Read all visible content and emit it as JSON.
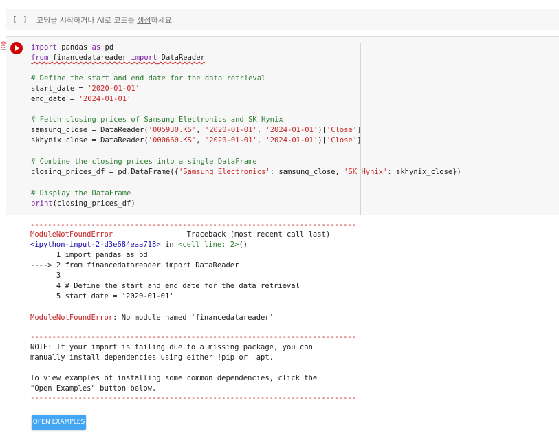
{
  "empty_cell": {
    "brackets": "[ ]",
    "placeholder_pre": "코딩을 시작하거나 AI로 코드를 ",
    "placeholder_link": "생성",
    "placeholder_post": "하세요."
  },
  "code_cell": {
    "exec_status": "0초",
    "lines": {
      "l1_kw1": "import",
      "l1_rest": " pandas ",
      "l1_kw2": "as",
      "l1_end": " pd",
      "l2_kw1": "from",
      "l2_mod": " financedatareader ",
      "l2_kw2": "import",
      "l2_end": " DataReader",
      "l4": "# Define the start and end date for the data retrieval",
      "l5_a": "start_date = ",
      "l5_s": "'2020-01-01'",
      "l6_a": "end_date = ",
      "l6_s": "'2024-01-01'",
      "l8": "# Fetch closing prices of Samsung Electronics and SK Hynix",
      "l9_a": "samsung_close = DataReader(",
      "l9_s1": "'005930.KS'",
      "l9_c1": ", ",
      "l9_s2": "'2020-01-01'",
      "l9_c2": ", ",
      "l9_s3": "'2024-01-01'",
      "l9_b": ")[",
      "l9_s4": "'Close'",
      "l9_e": "]",
      "l10_a": "skhynix_close = DataReader(",
      "l10_s1": "'000660.KS'",
      "l10_c1": ", ",
      "l10_s2": "'2020-01-01'",
      "l10_c2": ", ",
      "l10_s3": "'2024-01-01'",
      "l10_b": ")[",
      "l10_s4": "'Close'",
      "l10_e": "]",
      "l12": "# Combine the closing prices into a single DataFrame",
      "l13_a": "closing_prices_df = pd.DataFrame({",
      "l13_s1": "'Samsung Electronics'",
      "l13_b": ": samsung_close, ",
      "l13_s2": "'SK Hynix'",
      "l13_c": ": skhynix_close})",
      "l15": "# Display the DataFrame",
      "l16_kw": "print",
      "l16_rest": "(closing_prices_df)"
    }
  },
  "output": {
    "dashes": "---------------------------------------------------------------------------",
    "error_name": "ModuleNotFoundError",
    "traceback_hdr": "                 Traceback (most recent call last)",
    "input_link": "<ipython-input-2-d3e684eaa718>",
    "in_text": " in ",
    "cell_line": "<cell line: 2>",
    "paren": "()",
    "tb1": "      1 import pandas as pd",
    "tb2": "----> 2 from financedatareader import DataReader",
    "tb3": "      3",
    "tb4": "      4 # Define the start and end date for the data retrieval",
    "tb5": "      5 start_date = '2020-01-01'",
    "err_name2": "ModuleNotFoundError",
    "err_msg": ": No module named 'financedatareader'",
    "note1": "NOTE: If your import is failing due to a missing package, you can",
    "note2": "manually install dependencies using either !pip or !apt.",
    "note3": "To view examples of installing some common dependencies, click the",
    "note4": "\"Open Examples\" button below.",
    "open_examples": "OPEN EXAMPLES"
  }
}
